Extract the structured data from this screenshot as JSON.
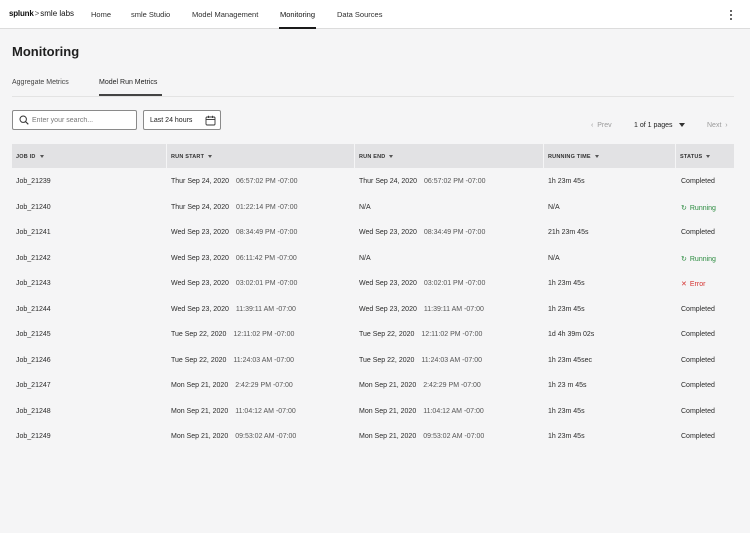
{
  "header": {
    "logo_brand": "splunk",
    "logo_arrow": ">",
    "logo_product": "smle labs",
    "nav": [
      {
        "label": "Home"
      },
      {
        "label": "smle Studio"
      },
      {
        "label": "Model Management"
      },
      {
        "label": "Monitoring",
        "active": true
      },
      {
        "label": "Data Sources"
      }
    ],
    "more_icon": "kebab-vertical-icon"
  },
  "page": {
    "title": "Monitoring",
    "tabs": [
      {
        "label": "Aggregate Metrics"
      },
      {
        "label": "Model Run Metrics",
        "active": true
      }
    ]
  },
  "toolbar": {
    "search_placeholder": "Enter your search...",
    "date_range": "Last 24 hours",
    "pager": {
      "prev": "Prev",
      "current": "1 of 1 pages",
      "next": "Next"
    }
  },
  "table": {
    "columns": [
      "JOB ID",
      "RUN START",
      "RUN END",
      "RUNNING TIME",
      "STATUS"
    ],
    "rows": [
      {
        "job": "Job_21239",
        "start_date": "Thur Sep 24, 2020",
        "start_time": "06:57:02 PM -07:00",
        "end_date": "Thur Sep 24, 2020",
        "end_time": "06:57:02 PM -07:00",
        "running": "1h 23m 45s",
        "status": "Completed"
      },
      {
        "job": "Job_21240",
        "start_date": "Thur Sep 24, 2020",
        "start_time": "01:22:14 PM -07:00",
        "end_date": "N/A",
        "end_time": "",
        "running": "N/A",
        "status": "Running"
      },
      {
        "job": "Job_21241",
        "start_date": "Wed Sep 23, 2020",
        "start_time": "08:34:49 PM -07:00",
        "end_date": "Wed Sep 23, 2020",
        "end_time": "08:34:49 PM -07:00",
        "running": "21h 23m 45s",
        "status": "Completed"
      },
      {
        "job": "Job_21242",
        "start_date": "Wed Sep 23, 2020",
        "start_time": "06:11:42 PM -07:00",
        "end_date": "N/A",
        "end_time": "",
        "running": "N/A",
        "status": "Running"
      },
      {
        "job": "Job_21243",
        "start_date": "Wed Sep 23, 2020",
        "start_time": "03:02:01 PM -07:00",
        "end_date": "Wed Sep 23, 2020",
        "end_time": "03:02:01 PM -07:00",
        "running": "1h 23m 45s",
        "status": "Error"
      },
      {
        "job": "Job_21244",
        "start_date": "Wed Sep 23, 2020",
        "start_time": "11:39:11 AM -07:00",
        "end_date": "Wed Sep 23, 2020",
        "end_time": "11:39:11 AM -07:00",
        "running": "1h 23m 45s",
        "status": "Completed"
      },
      {
        "job": "Job_21245",
        "start_date": "Tue Sep 22, 2020",
        "start_time": "12:11:02 PM -07:00",
        "end_date": "Tue Sep 22, 2020",
        "end_time": "12:11:02 PM -07:00",
        "running": "1d 4h 39m 02s",
        "status": "Completed"
      },
      {
        "job": "Job_21246",
        "start_date": "Tue Sep 22, 2020",
        "start_time": "11:24:03 AM -07:00",
        "end_date": "Tue Sep 22, 2020",
        "end_time": "11:24:03 AM -07:00",
        "running": "1h 23m 45sec",
        "status": "Completed"
      },
      {
        "job": "Job_21247",
        "start_date": "Mon Sep 21, 2020",
        "start_time": "2:42:29 PM -07:00",
        "end_date": "Mon Sep 21, 2020",
        "end_time": "2:42:29 PM -07:00",
        "running": "1h 23 m 45s",
        "status": "Completed"
      },
      {
        "job": "Job_21248",
        "start_date": "Mon Sep 21, 2020",
        "start_time": "11:04:12 AM -07:00",
        "end_date": "Mon Sep 21, 2020",
        "end_time": "11:04:12 AM -07:00",
        "running": "1h 23m 45s",
        "status": "Completed"
      },
      {
        "job": "Job_21249",
        "start_date": "Mon Sep 21, 2020",
        "start_time": "09:53:02 AM -07:00",
        "end_date": "Mon Sep 21, 2020",
        "end_time": "09:53:02 AM -07:00",
        "running": "1h 23m 45s",
        "status": "Completed"
      }
    ]
  },
  "colors": {
    "running": "#2a8b3f",
    "error": "#d4312f",
    "header_bg": "#e2e2e4"
  }
}
